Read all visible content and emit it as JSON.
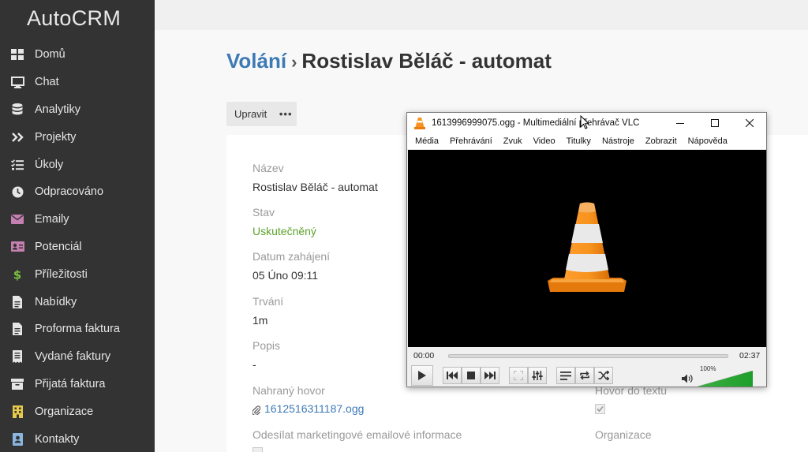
{
  "app": {
    "logo": "AutoCRM"
  },
  "sidebar": {
    "items": [
      {
        "label": "Domů",
        "icon": "grid-icon"
      },
      {
        "label": "Chat",
        "icon": "monitor-icon"
      },
      {
        "label": "Analytiky",
        "icon": "database-icon"
      },
      {
        "label": "Projekty",
        "icon": "chevrons-right-icon"
      },
      {
        "label": "Úkoly",
        "icon": "checklist-icon"
      },
      {
        "label": "Odpracováno",
        "icon": "clock-icon"
      },
      {
        "label": "Emaily",
        "icon": "envelope-icon"
      },
      {
        "label": "Potenciál",
        "icon": "id-card-icon"
      },
      {
        "label": "Příležitosti",
        "icon": "dollar-icon"
      },
      {
        "label": "Nabídky",
        "icon": "document-icon"
      },
      {
        "label": "Proforma faktura",
        "icon": "document-icon"
      },
      {
        "label": "Vydané faktury",
        "icon": "receipt-icon"
      },
      {
        "label": "Přijatá faktura",
        "icon": "archive-icon"
      },
      {
        "label": "Organizace",
        "icon": "building-icon"
      },
      {
        "label": "Kontakty",
        "icon": "contact-icon"
      }
    ]
  },
  "header": {
    "breadcrumb_link": "Volání",
    "separator": "›",
    "record_name": "Rostislav Běláč - automat"
  },
  "toolbar": {
    "edit_label": "Upravit",
    "more_label": "•••"
  },
  "record": {
    "name_label": "Název",
    "name_value": "Rostislav Běláč - automat",
    "status_label": "Stav",
    "status_value": "Uskutečněný",
    "start_label": "Datum zahájení",
    "start_value": "05 Úno 09:11",
    "duration_label": "Trvání",
    "duration_value": "1m",
    "description_label": "Popis",
    "description_value": "-",
    "recording_label": "Nahraný hovor",
    "recording_file": "1612516311187.ogg",
    "marketing_label": "Odesílat marketingové emailové informace",
    "transcription_label": "Hovor do textu",
    "organization_label": "Organizace"
  },
  "vlc": {
    "title": "1613996999075.ogg - Multimediální přehrávač VLC",
    "menu": [
      "Média",
      "Přehrávání",
      "Zvuk",
      "Video",
      "Titulky",
      "Nástroje",
      "Zobrazit",
      "Nápověda"
    ],
    "time_elapsed": "00:00",
    "time_total": "02:37",
    "volume_label": "100%",
    "playback_progress": 0.0,
    "volume_level": 1.0
  },
  "colors": {
    "sidebar_bg": "#333333",
    "link": "#3d7ab5",
    "status_green": "#5ba22a",
    "vlc_orange": "#f7931e"
  }
}
